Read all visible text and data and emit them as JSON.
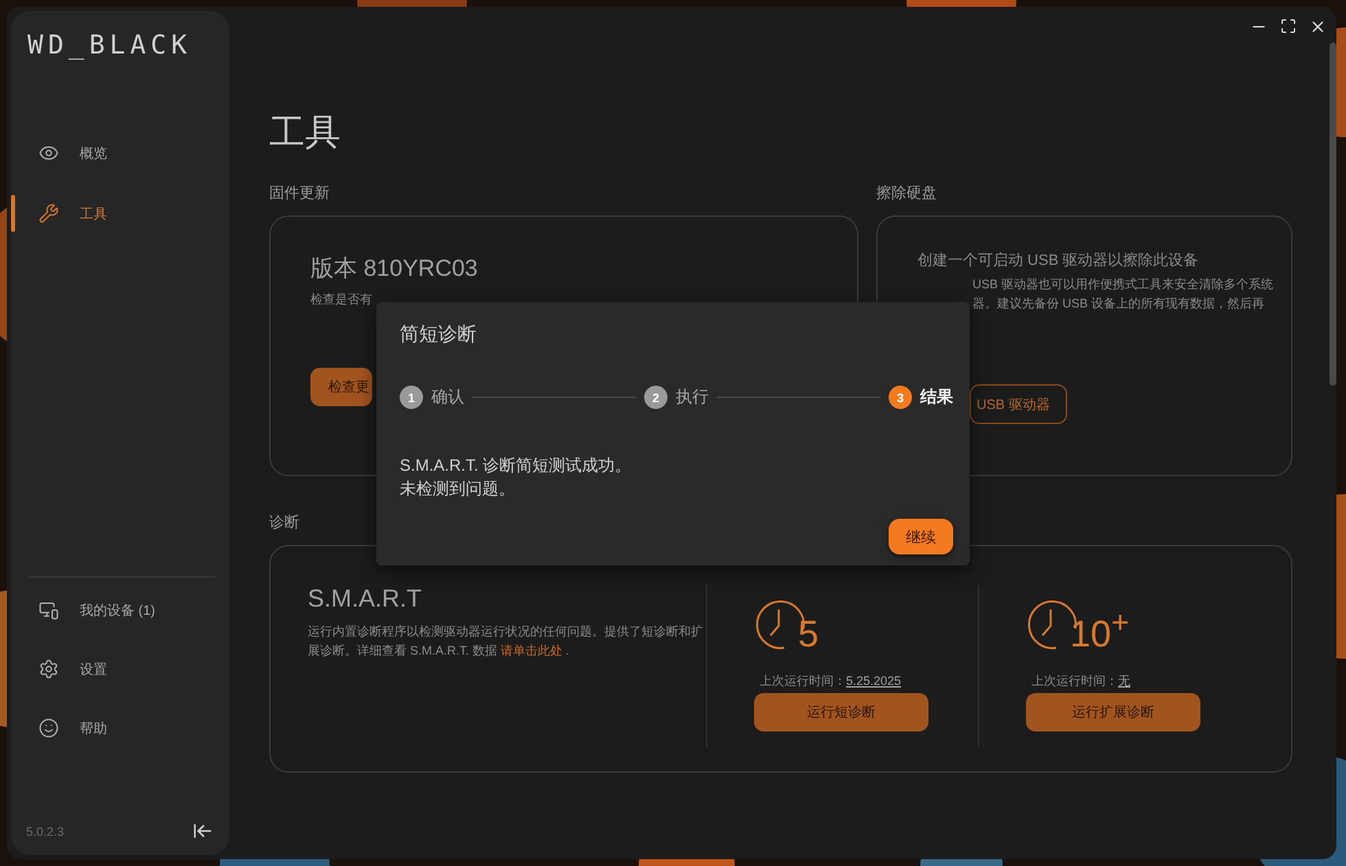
{
  "sidebar": {
    "logo": "WD_BLACK",
    "items": [
      {
        "label": "概览",
        "selected": false
      },
      {
        "label": "工具",
        "selected": true
      }
    ],
    "bottom_items": [
      {
        "label": "我的设备 (1)"
      },
      {
        "label": "设置"
      },
      {
        "label": "帮助"
      }
    ],
    "version": "5.0.2.3"
  },
  "page_title": "工具",
  "firmware": {
    "heading": "固件更新",
    "title": "版本 810YRC03",
    "description": "检查是否有",
    "button": "检查更"
  },
  "erase": {
    "heading": "擦除硬盘",
    "title": "创建一个可启动 USB 驱动器以擦除此设备",
    "lines": [
      "USB 驱动器也可以用作便携式工具来安全清除多个系统",
      "器。建议先备份 USB 设备上的所有现有数据，然后再"
    ],
    "button": "USB 驱动器"
  },
  "diagnostics": {
    "heading": "诊断",
    "title": "S.M.A.R.T",
    "description": "运行内置诊断程序以检测驱动器运行状况的任何问题。提供了短诊断和扩展诊断。详细查看 S.M.A.R.T. 数据",
    "link": "请单击此处",
    "link_suffix": ".",
    "tests": [
      {
        "minutes": "5",
        "last_run_label": "上次运行时间：",
        "last_run": "5.25.2025",
        "button": "运行短诊断"
      },
      {
        "minutes": "10$^{+}$",
        "last_run_label": "上次运行时间：",
        "last_run": "无",
        "button": "运行扩展诊断"
      }
    ]
  },
  "dialog": {
    "title": "简短诊断",
    "steps": [
      {
        "number": "1",
        "label": "确认",
        "selected": false
      },
      {
        "number": "2",
        "label": "执行",
        "selected": false
      },
      {
        "number": "3",
        "label": "结果",
        "selected": true
      }
    ],
    "message": [
      "S.M.A.R.T. 诊断简短测试成功。",
      "未检测到问题。"
    ],
    "button": "继续"
  }
}
